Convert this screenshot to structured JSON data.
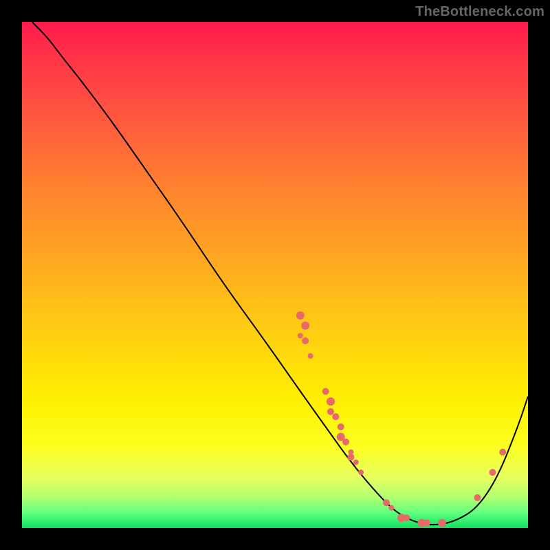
{
  "watermark": "TheBottleneck.com",
  "chart_data": {
    "type": "line",
    "title": "",
    "xlabel": "",
    "ylabel": "",
    "xlim": [
      0,
      100
    ],
    "ylim": [
      0,
      100
    ],
    "grid": false,
    "series": [
      {
        "name": "curve",
        "x": [
          2,
          5,
          8,
          12,
          18,
          25,
          32,
          40,
          48,
          55,
          60,
          65,
          70,
          74,
          78,
          82,
          86,
          90,
          94,
          98,
          100
        ],
        "y": [
          100,
          97,
          93,
          88,
          80,
          70,
          60,
          48,
          37,
          27,
          20,
          13,
          7,
          3,
          1,
          0.5,
          1.5,
          4,
          10,
          20,
          26
        ],
        "stroke": "#000000",
        "strokeWidth": 2
      }
    ],
    "points": [
      {
        "x": 55,
        "y": 42,
        "r": 6
      },
      {
        "x": 55,
        "y": 38,
        "r": 4
      },
      {
        "x": 56,
        "y": 37,
        "r": 5
      },
      {
        "x": 56,
        "y": 40,
        "r": 6
      },
      {
        "x": 57,
        "y": 34,
        "r": 4
      },
      {
        "x": 60,
        "y": 27,
        "r": 5
      },
      {
        "x": 61,
        "y": 25,
        "r": 6
      },
      {
        "x": 61,
        "y": 23,
        "r": 5
      },
      {
        "x": 62,
        "y": 22,
        "r": 5
      },
      {
        "x": 63,
        "y": 20,
        "r": 5
      },
      {
        "x": 63,
        "y": 18,
        "r": 6
      },
      {
        "x": 64,
        "y": 17,
        "r": 5
      },
      {
        "x": 65,
        "y": 15,
        "r": 4
      },
      {
        "x": 65,
        "y": 14,
        "r": 5
      },
      {
        "x": 66,
        "y": 13,
        "r": 4
      },
      {
        "x": 67,
        "y": 11,
        "r": 4
      },
      {
        "x": 72,
        "y": 5,
        "r": 5
      },
      {
        "x": 73,
        "y": 4,
        "r": 4
      },
      {
        "x": 75,
        "y": 2,
        "r": 6
      },
      {
        "x": 76,
        "y": 2,
        "r": 5
      },
      {
        "x": 79,
        "y": 1,
        "r": 6
      },
      {
        "x": 80,
        "y": 1,
        "r": 5
      },
      {
        "x": 83,
        "y": 1,
        "r": 6
      },
      {
        "x": 90,
        "y": 6,
        "r": 5
      },
      {
        "x": 93,
        "y": 11,
        "r": 5
      },
      {
        "x": 95,
        "y": 15,
        "r": 5
      }
    ],
    "point_color": "#e66a6a"
  }
}
